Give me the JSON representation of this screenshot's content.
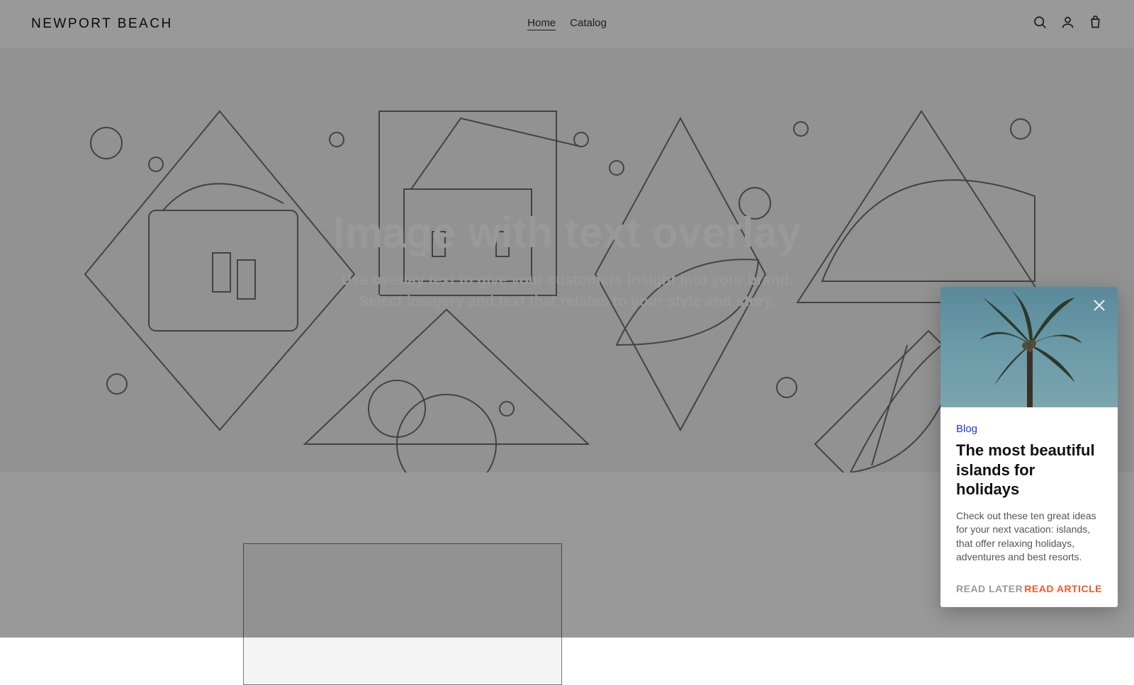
{
  "header": {
    "logo": "NEWPORT BEACH",
    "nav": [
      {
        "label": "Home",
        "active": true
      },
      {
        "label": "Catalog",
        "active": false
      }
    ],
    "icons": {
      "search": "search-icon",
      "account": "user-icon",
      "cart": "cart-icon"
    }
  },
  "hero": {
    "title": "Image with text overlay",
    "subtitle": "Use overlay text to give your customers insight into your brand. Select imagery and text that relates to your style and story."
  },
  "popup": {
    "tag": "Blog",
    "title": "The most beautiful islands for holidays",
    "text": "Check out these ten great ideas for your next vacation: islands, that offer relaxing holidays, adventures and best resorts.",
    "actions": {
      "later": "READ LATER",
      "read": "READ ARTICLE"
    }
  }
}
